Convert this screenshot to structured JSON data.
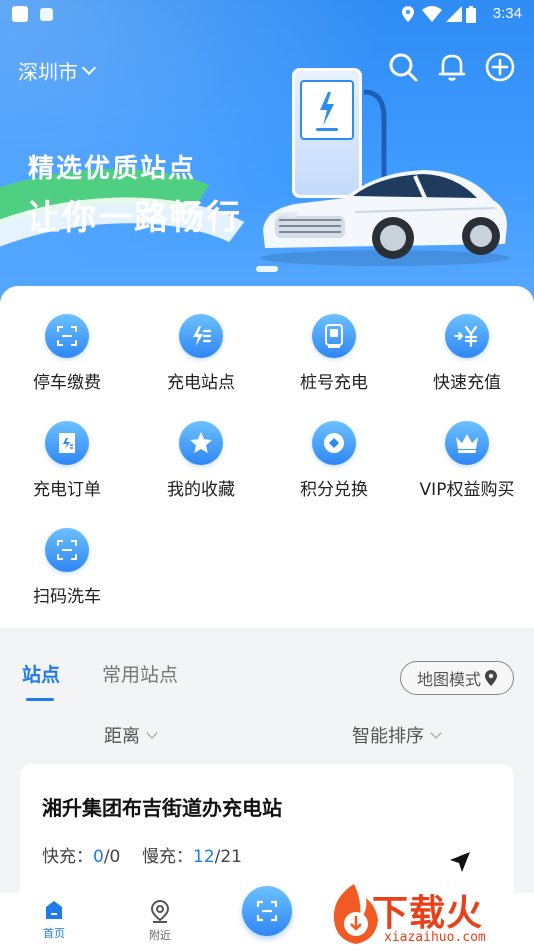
{
  "status_bar": {
    "time": "3:34"
  },
  "header": {
    "city": "深圳市",
    "slogan_line1": "精选优质站点",
    "slogan_line2": "让你一路畅行",
    "icons": [
      "search-icon",
      "bell-icon",
      "plus-circle-icon"
    ]
  },
  "grid": {
    "items": [
      {
        "label": "停车缴费",
        "icon": "parking-scan-icon"
      },
      {
        "label": "充电站点",
        "icon": "charging-station-icon"
      },
      {
        "label": "桩号充电",
        "icon": "pile-charge-icon"
      },
      {
        "label": "快速充值",
        "icon": "yuan-recharge-icon"
      },
      {
        "label": "充电订单",
        "icon": "order-icon"
      },
      {
        "label": "我的收藏",
        "icon": "star-icon"
      },
      {
        "label": "积分兑换",
        "icon": "points-icon"
      },
      {
        "label": "VIP权益购买",
        "icon": "crown-icon"
      },
      {
        "label": "扫码洗车",
        "icon": "scan-wash-icon"
      }
    ]
  },
  "tabs": {
    "items": [
      {
        "label": "站点",
        "active": true
      },
      {
        "label": "常用站点",
        "active": false
      }
    ],
    "map_mode_label": "地图模式"
  },
  "filters": {
    "distance": "距离",
    "sort": "智能排序"
  },
  "station": {
    "name": "湘升集团布吉街道办充电站",
    "fast_label": "快充：",
    "fast_available": "0",
    "fast_total": "/0",
    "slow_label": "慢充：",
    "slow_available": "12",
    "slow_total": "/21"
  },
  "bottom_nav": {
    "items": [
      {
        "label": "首页",
        "active": true
      },
      {
        "label": "附近",
        "active": false
      }
    ]
  },
  "watermark": {
    "brand": "下载火",
    "url": "xiazaihuo.com"
  },
  "colors": {
    "primary": "#1e7be8",
    "banner": "#3f9bff",
    "accent_green": "#4fd27b",
    "watermark": "#e84018"
  }
}
